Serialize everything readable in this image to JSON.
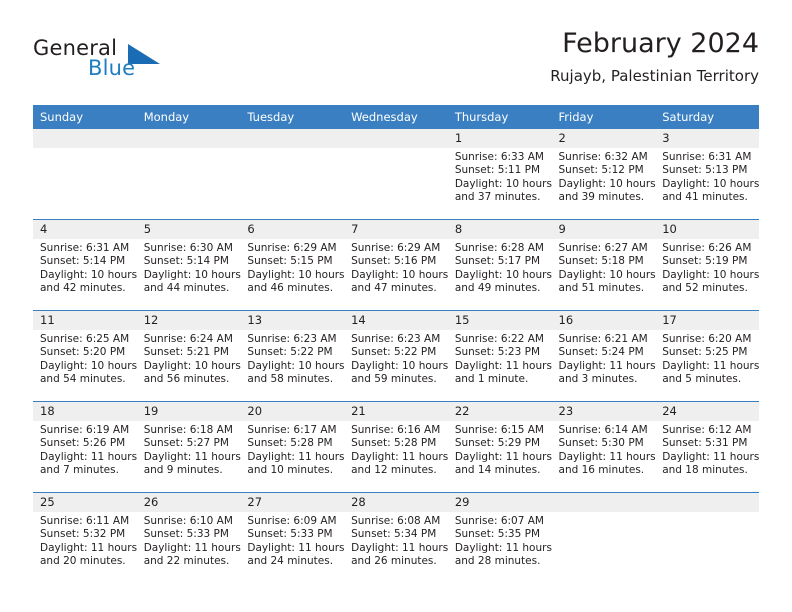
{
  "brand": {
    "name_part1": "General",
    "name_part2": "Blue",
    "accent_color": "#1a6cb5"
  },
  "header": {
    "title": "February 2024",
    "subtitle": "Rujayb, Palestinian Territory"
  },
  "calendar": {
    "header_color": "#3a7fc1",
    "daynum_band_color": "#efefef",
    "weekday_headers": [
      "Sunday",
      "Monday",
      "Tuesday",
      "Wednesday",
      "Thursday",
      "Friday",
      "Saturday"
    ],
    "weeks": [
      [
        {
          "day": "",
          "lines": []
        },
        {
          "day": "",
          "lines": []
        },
        {
          "day": "",
          "lines": []
        },
        {
          "day": "",
          "lines": []
        },
        {
          "day": "1",
          "lines": [
            "Sunrise: 6:33 AM",
            "Sunset: 5:11 PM",
            "Daylight: 10 hours",
            "and 37 minutes."
          ]
        },
        {
          "day": "2",
          "lines": [
            "Sunrise: 6:32 AM",
            "Sunset: 5:12 PM",
            "Daylight: 10 hours",
            "and 39 minutes."
          ]
        },
        {
          "day": "3",
          "lines": [
            "Sunrise: 6:31 AM",
            "Sunset: 5:13 PM",
            "Daylight: 10 hours",
            "and 41 minutes."
          ]
        }
      ],
      [
        {
          "day": "4",
          "lines": [
            "Sunrise: 6:31 AM",
            "Sunset: 5:14 PM",
            "Daylight: 10 hours",
            "and 42 minutes."
          ]
        },
        {
          "day": "5",
          "lines": [
            "Sunrise: 6:30 AM",
            "Sunset: 5:14 PM",
            "Daylight: 10 hours",
            "and 44 minutes."
          ]
        },
        {
          "day": "6",
          "lines": [
            "Sunrise: 6:29 AM",
            "Sunset: 5:15 PM",
            "Daylight: 10 hours",
            "and 46 minutes."
          ]
        },
        {
          "day": "7",
          "lines": [
            "Sunrise: 6:29 AM",
            "Sunset: 5:16 PM",
            "Daylight: 10 hours",
            "and 47 minutes."
          ]
        },
        {
          "day": "8",
          "lines": [
            "Sunrise: 6:28 AM",
            "Sunset: 5:17 PM",
            "Daylight: 10 hours",
            "and 49 minutes."
          ]
        },
        {
          "day": "9",
          "lines": [
            "Sunrise: 6:27 AM",
            "Sunset: 5:18 PM",
            "Daylight: 10 hours",
            "and 51 minutes."
          ]
        },
        {
          "day": "10",
          "lines": [
            "Sunrise: 6:26 AM",
            "Sunset: 5:19 PM",
            "Daylight: 10 hours",
            "and 52 minutes."
          ]
        }
      ],
      [
        {
          "day": "11",
          "lines": [
            "Sunrise: 6:25 AM",
            "Sunset: 5:20 PM",
            "Daylight: 10 hours",
            "and 54 minutes."
          ]
        },
        {
          "day": "12",
          "lines": [
            "Sunrise: 6:24 AM",
            "Sunset: 5:21 PM",
            "Daylight: 10 hours",
            "and 56 minutes."
          ]
        },
        {
          "day": "13",
          "lines": [
            "Sunrise: 6:23 AM",
            "Sunset: 5:22 PM",
            "Daylight: 10 hours",
            "and 58 minutes."
          ]
        },
        {
          "day": "14",
          "lines": [
            "Sunrise: 6:23 AM",
            "Sunset: 5:22 PM",
            "Daylight: 10 hours",
            "and 59 minutes."
          ]
        },
        {
          "day": "15",
          "lines": [
            "Sunrise: 6:22 AM",
            "Sunset: 5:23 PM",
            "Daylight: 11 hours",
            "and 1 minute."
          ]
        },
        {
          "day": "16",
          "lines": [
            "Sunrise: 6:21 AM",
            "Sunset: 5:24 PM",
            "Daylight: 11 hours",
            "and 3 minutes."
          ]
        },
        {
          "day": "17",
          "lines": [
            "Sunrise: 6:20 AM",
            "Sunset: 5:25 PM",
            "Daylight: 11 hours",
            "and 5 minutes."
          ]
        }
      ],
      [
        {
          "day": "18",
          "lines": [
            "Sunrise: 6:19 AM",
            "Sunset: 5:26 PM",
            "Daylight: 11 hours",
            "and 7 minutes."
          ]
        },
        {
          "day": "19",
          "lines": [
            "Sunrise: 6:18 AM",
            "Sunset: 5:27 PM",
            "Daylight: 11 hours",
            "and 9 minutes."
          ]
        },
        {
          "day": "20",
          "lines": [
            "Sunrise: 6:17 AM",
            "Sunset: 5:28 PM",
            "Daylight: 11 hours",
            "and 10 minutes."
          ]
        },
        {
          "day": "21",
          "lines": [
            "Sunrise: 6:16 AM",
            "Sunset: 5:28 PM",
            "Daylight: 11 hours",
            "and 12 minutes."
          ]
        },
        {
          "day": "22",
          "lines": [
            "Sunrise: 6:15 AM",
            "Sunset: 5:29 PM",
            "Daylight: 11 hours",
            "and 14 minutes."
          ]
        },
        {
          "day": "23",
          "lines": [
            "Sunrise: 6:14 AM",
            "Sunset: 5:30 PM",
            "Daylight: 11 hours",
            "and 16 minutes."
          ]
        },
        {
          "day": "24",
          "lines": [
            "Sunrise: 6:12 AM",
            "Sunset: 5:31 PM",
            "Daylight: 11 hours",
            "and 18 minutes."
          ]
        }
      ],
      [
        {
          "day": "25",
          "lines": [
            "Sunrise: 6:11 AM",
            "Sunset: 5:32 PM",
            "Daylight: 11 hours",
            "and 20 minutes."
          ]
        },
        {
          "day": "26",
          "lines": [
            "Sunrise: 6:10 AM",
            "Sunset: 5:33 PM",
            "Daylight: 11 hours",
            "and 22 minutes."
          ]
        },
        {
          "day": "27",
          "lines": [
            "Sunrise: 6:09 AM",
            "Sunset: 5:33 PM",
            "Daylight: 11 hours",
            "and 24 minutes."
          ]
        },
        {
          "day": "28",
          "lines": [
            "Sunrise: 6:08 AM",
            "Sunset: 5:34 PM",
            "Daylight: 11 hours",
            "and 26 minutes."
          ]
        },
        {
          "day": "29",
          "lines": [
            "Sunrise: 6:07 AM",
            "Sunset: 5:35 PM",
            "Daylight: 11 hours",
            "and 28 minutes."
          ]
        },
        {
          "day": "",
          "lines": []
        },
        {
          "day": "",
          "lines": []
        }
      ]
    ]
  }
}
